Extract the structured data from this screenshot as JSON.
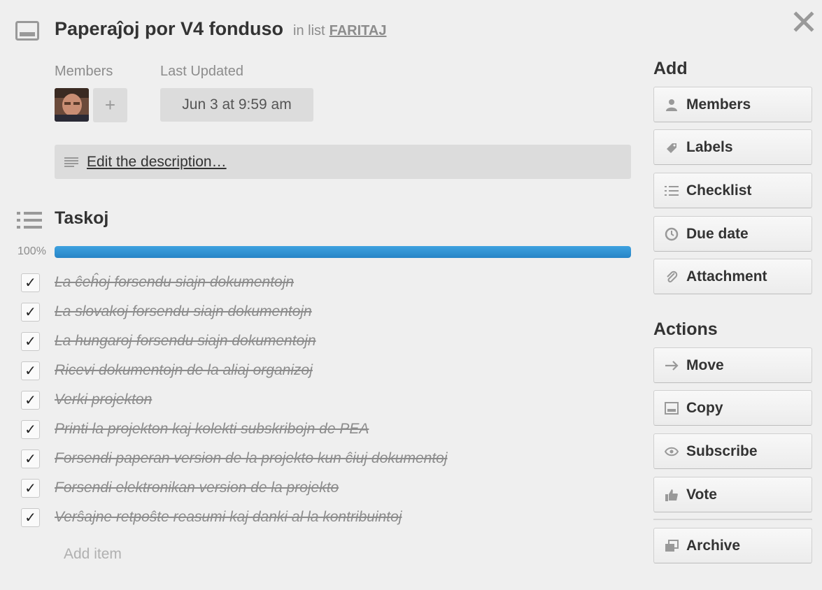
{
  "card": {
    "title": "Paperaĵoj por V4 fonduso",
    "in_list": "in list",
    "list_name": "FARITAJ"
  },
  "members": {
    "label": "Members",
    "add_label": "+"
  },
  "last_updated": {
    "label": "Last Updated",
    "value": "Jun 3 at 9:59 am"
  },
  "description": {
    "link": "Edit the description…"
  },
  "checklist": {
    "title": "Taskoj",
    "percent_label": "100%",
    "progress": 1.0,
    "items": [
      {
        "text": "La ĉeĥoj forsendu siajn dokumentojn",
        "checked": true,
        "mark": "✓"
      },
      {
        "text": "La slovakoj forsendu siajn dokumentojn",
        "checked": true,
        "mark": "✓"
      },
      {
        "text": "La hungaroj forsendu siajn dokumentojn",
        "checked": true,
        "mark": "✓"
      },
      {
        "text": "Ricevi dokumentojn de la aliaj organizoj",
        "checked": true,
        "mark": "✓"
      },
      {
        "text": "Verki projekton",
        "checked": true,
        "mark": "✓"
      },
      {
        "text": "Printi la projekton kaj kolekti subskribojn de PEA",
        "checked": true,
        "mark": "✓"
      },
      {
        "text": "Forsendi paperan version de la projekto kun ĉiuj dokumentoj",
        "checked": true,
        "mark": "✓"
      },
      {
        "text": "Forsendi elektronikan version de la projekto",
        "checked": true,
        "mark": "✓"
      },
      {
        "text": "Verŝajne retpoŝte reasumi kaj danki al la kontribuintoj",
        "checked": true,
        "mark": "✓"
      }
    ],
    "add_item": "Add item"
  },
  "sidebar": {
    "add_heading": "Add",
    "add_buttons": [
      {
        "label": "Members",
        "icon": "person-icon"
      },
      {
        "label": "Labels",
        "icon": "tag-icon"
      },
      {
        "label": "Checklist",
        "icon": "list-icon"
      },
      {
        "label": "Due date",
        "icon": "clock-icon"
      },
      {
        "label": "Attachment",
        "icon": "paperclip-icon"
      }
    ],
    "actions_heading": "Actions",
    "action_buttons": [
      {
        "label": "Move",
        "icon": "arrow-right-icon"
      },
      {
        "label": "Copy",
        "icon": "card-icon"
      },
      {
        "label": "Subscribe",
        "icon": "eye-icon"
      },
      {
        "label": "Vote",
        "icon": "thumbs-up-icon"
      }
    ],
    "archive_button": {
      "label": "Archive",
      "icon": "archive-icon"
    }
  },
  "colors": {
    "background": "#efefef",
    "progress": "#2c8fd3",
    "muted_text": "#8c8c8c"
  }
}
